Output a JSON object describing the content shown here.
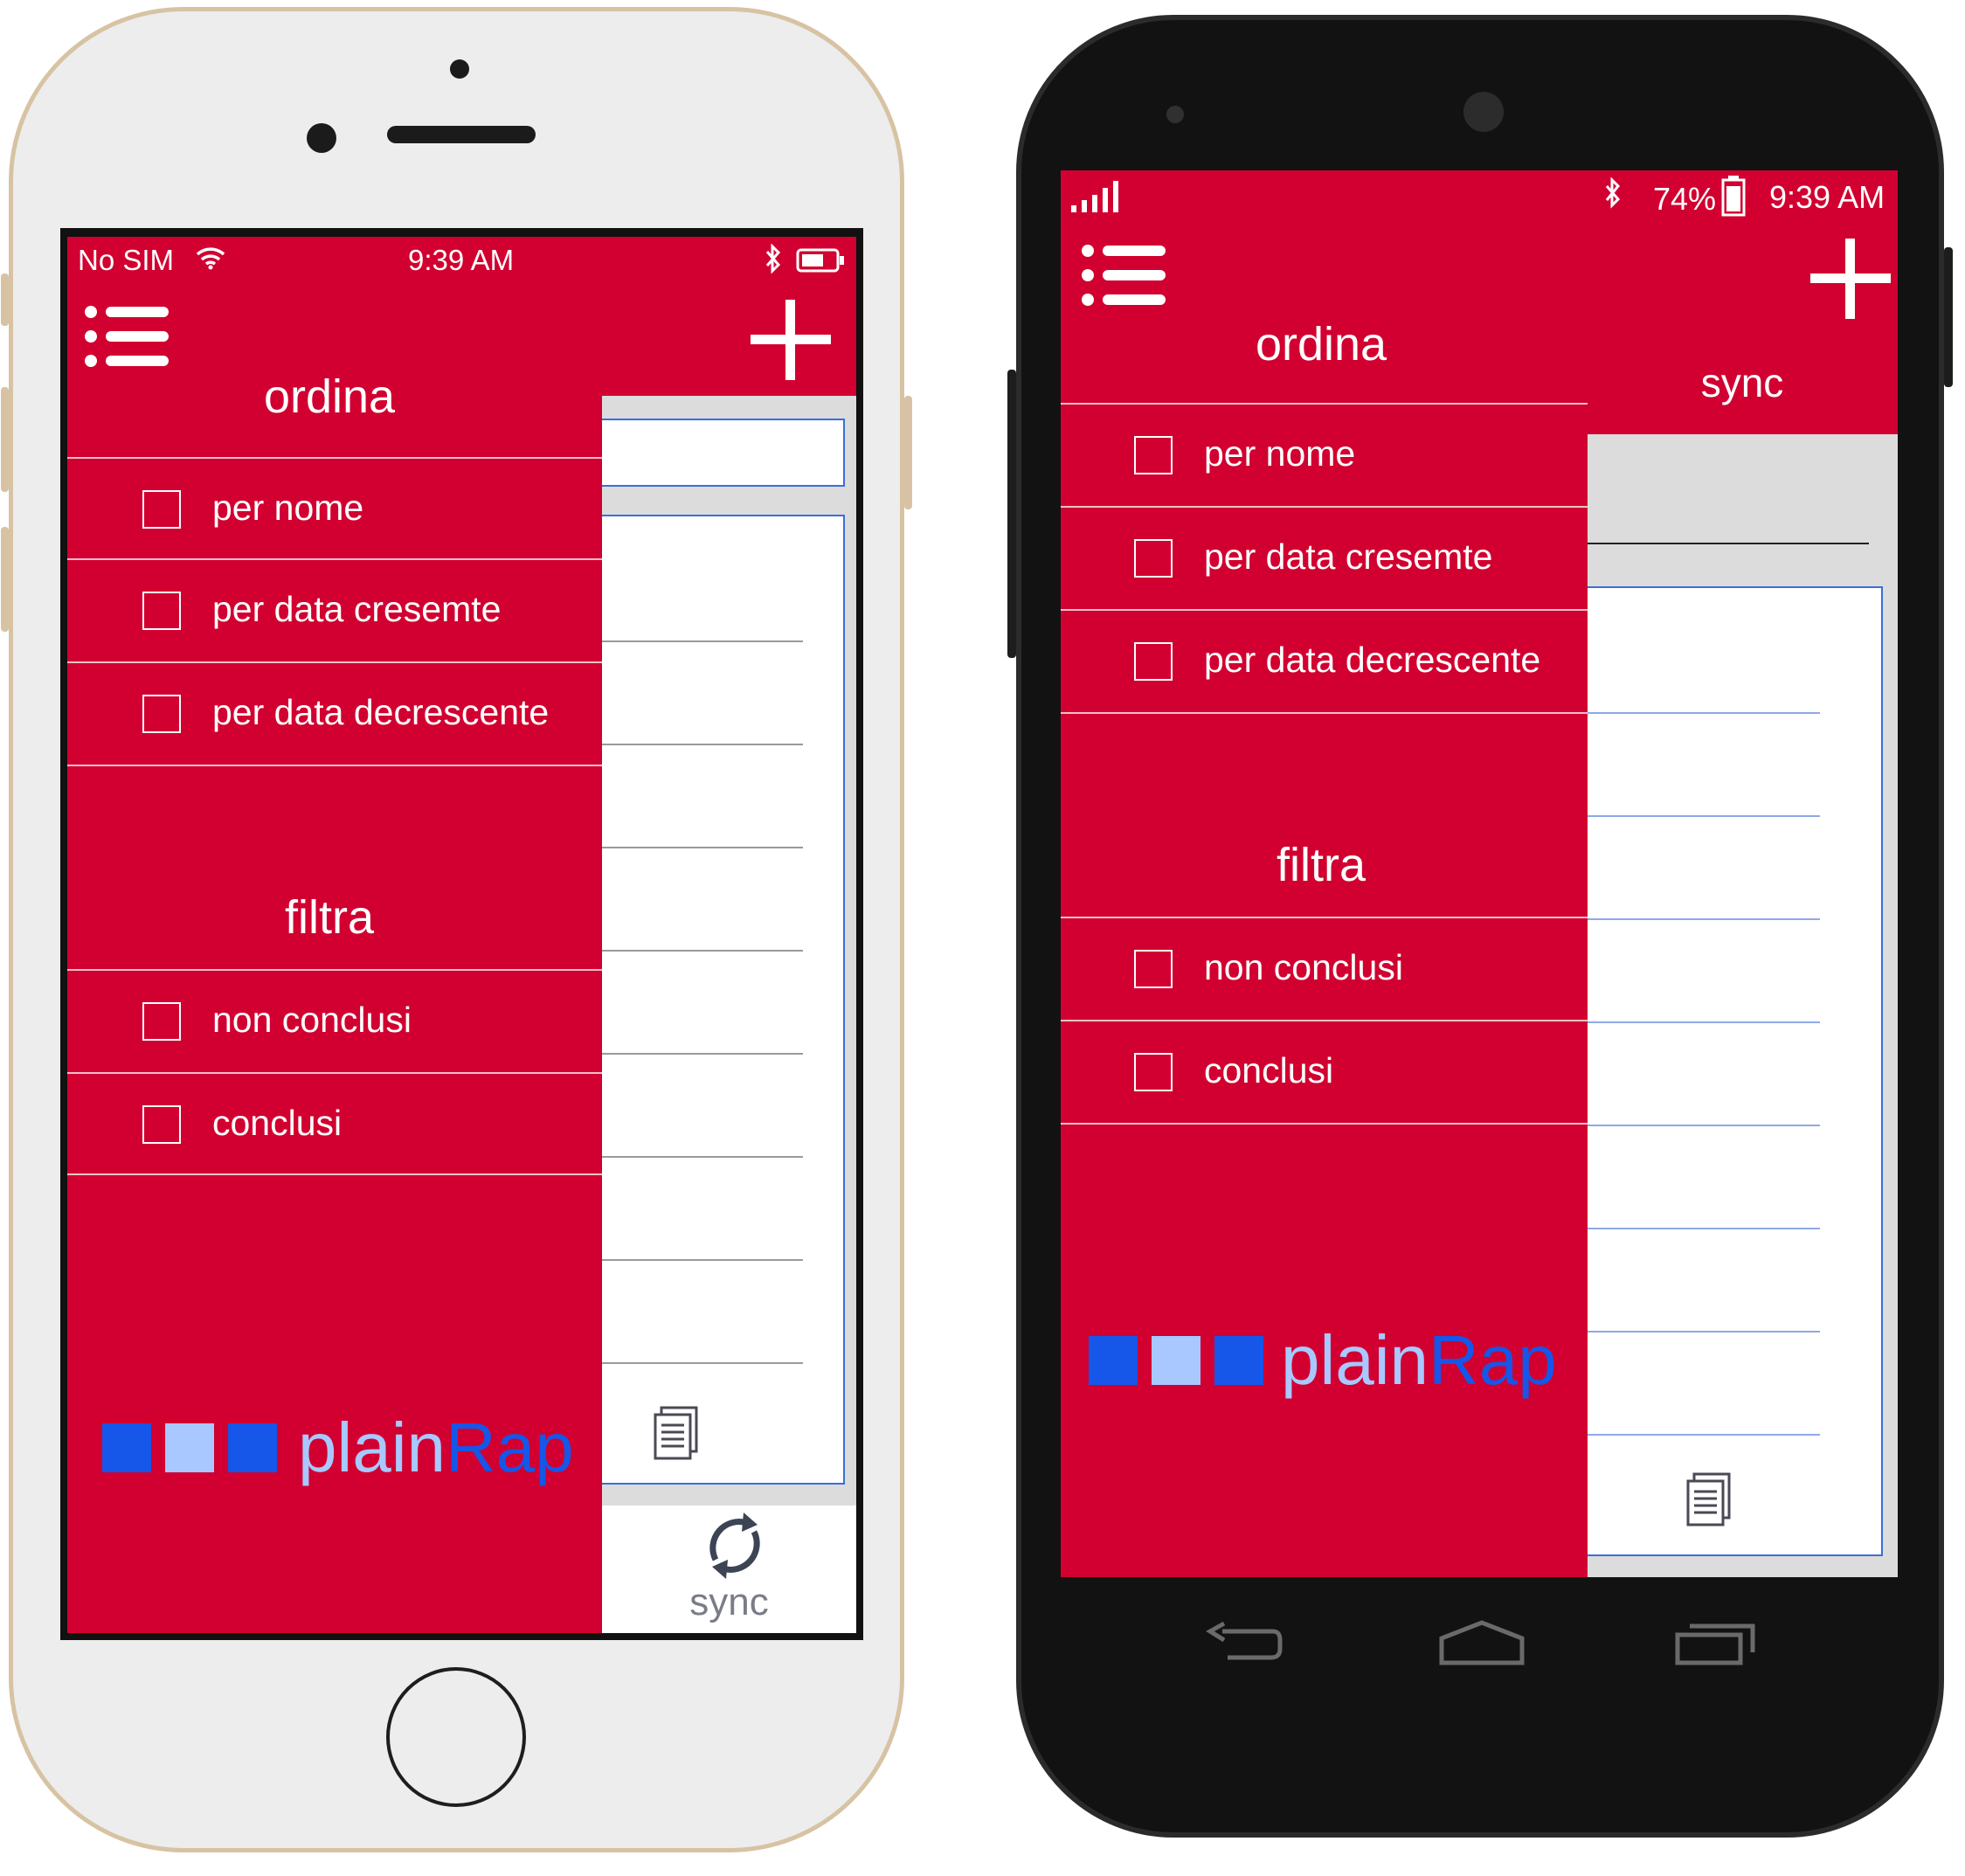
{
  "ios": {
    "status": {
      "carrier": "No SIM",
      "time": "9:39 AM"
    },
    "drawer": {
      "sort_title": "ordina",
      "sort_options": [
        {
          "label": "per nome",
          "checked": false
        },
        {
          "label": "per data cresemte",
          "checked": false
        },
        {
          "label": "per data decrescente",
          "checked": false
        }
      ],
      "filter_title": "filtra",
      "filter_options": [
        {
          "label": "non conclusi",
          "checked": false
        },
        {
          "label": "conclusi",
          "checked": false
        }
      ],
      "logo": {
        "part1": "plain",
        "part2": "Rap"
      }
    },
    "sync_label": "sync"
  },
  "android": {
    "status": {
      "battery": "74%",
      "time": "9:39 AM"
    },
    "drawer": {
      "sort_title": "ordina",
      "sort_options": [
        {
          "label": "per nome",
          "checked": false
        },
        {
          "label": "per data cresemte",
          "checked": false
        },
        {
          "label": "per data decrescente",
          "checked": false
        }
      ],
      "filter_title": "filtra",
      "filter_options": [
        {
          "label": "non conclusi",
          "checked": false
        },
        {
          "label": "conclusi",
          "checked": false
        }
      ],
      "logo": {
        "part1": "plain",
        "part2": "Rap"
      }
    },
    "sync_label": "sync"
  },
  "colors": {
    "brand_red": "#d10030",
    "logo_blue_dark": "#1656e8",
    "logo_blue_light": "#a8c8ff",
    "list_border_blue": "#3a6fd8"
  },
  "icons": [
    "menu-list-icon",
    "add-icon",
    "wifi-icon",
    "bluetooth-icon",
    "battery-icon",
    "signal-icon",
    "document-icon",
    "sync-icon",
    "back-icon",
    "home-icon",
    "recents-icon"
  ]
}
